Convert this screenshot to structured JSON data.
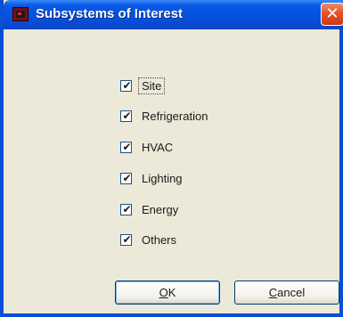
{
  "window": {
    "title": "Subsystems of Interest",
    "close_label": "✕"
  },
  "options": [
    {
      "label": "Site",
      "checked": true
    },
    {
      "label": "Refrigeration",
      "checked": true
    },
    {
      "label": "HVAC",
      "checked": true
    },
    {
      "label": "Lighting",
      "checked": true
    },
    {
      "label": "Energy",
      "checked": true
    },
    {
      "label": "Others",
      "checked": true
    }
  ],
  "checkmark": "✔",
  "buttons": {
    "ok": {
      "accel": "O",
      "rest": "K"
    },
    "cancel": {
      "accel": "C",
      "rest": "ancel"
    }
  }
}
